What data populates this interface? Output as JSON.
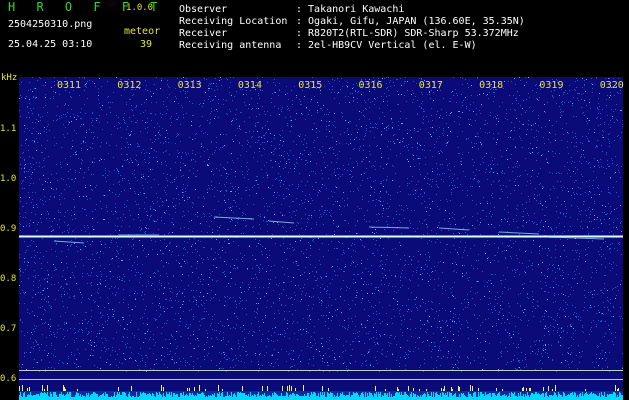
{
  "header": {
    "app_title": "H R O F F T",
    "app_version": "1.0.0",
    "file_name": "2504250310.png",
    "datetime": "25.04.25 03:10",
    "meteor_label": "meteor",
    "meteor_count": "39"
  },
  "info": [
    {
      "key": "Observer",
      "value": ": Takanori Kawachi"
    },
    {
      "key": "Receiving Location",
      "value": ": Ogaki, Gifu, JAPAN (136.60E, 35.35N)"
    },
    {
      "key": "Receiver",
      "value": ": R820T2(RTL-SDR) SDR-Sharp 53.372MHz"
    },
    {
      "key": "Receiving antenna",
      "value": ": 2el-HB9CV Vertical (el. E-W)"
    }
  ],
  "spectrogram": {
    "y_unit": "kHz",
    "y_ticks": [
      "1.1",
      "1.0",
      "0.9",
      "0.8",
      "0.7",
      "0.6"
    ],
    "x_ticks": [
      "0311",
      "0312",
      "0313",
      "0314",
      "0315",
      "0316",
      "0317",
      "0318",
      "0319",
      "0320"
    ],
    "colors": {
      "background": "#0a0a78",
      "noise": "#2e5fd8",
      "carrier": "#dfffff",
      "baseline": "#c8c8c8",
      "bottom_band": "#00d8ff",
      "axis_labels": "#e6e62a"
    }
  }
}
